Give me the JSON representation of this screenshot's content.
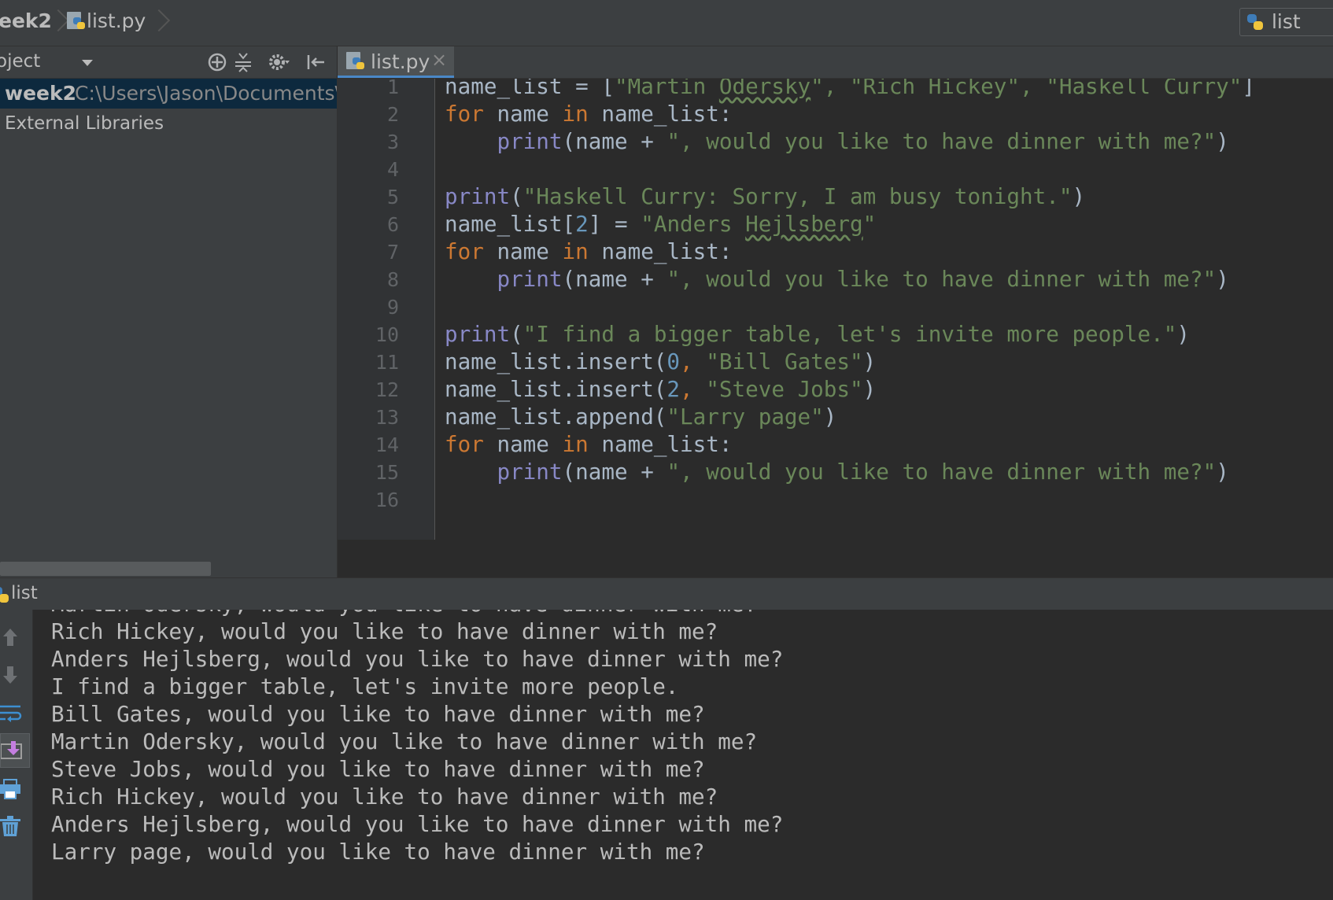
{
  "navbar": {
    "project_crumb": "eek2",
    "file_crumb": "list.py",
    "run_config_label": "list",
    "icons": [
      "python-file-icon",
      "chevron-right-icon"
    ]
  },
  "project_panel": {
    "title": "oject",
    "toolbar_icons": [
      "target-icon",
      "collapse-all-icon",
      "gear-icon",
      "hide-panel-icon"
    ],
    "tree": [
      {
        "name": "week2",
        "path": "C:\\Users\\Jason\\Documents\\C"
      },
      {
        "name": "External Libraries",
        "path": ""
      }
    ]
  },
  "editor": {
    "tab_label": "list.py",
    "tab_close": "×",
    "line_numbers": [
      "1",
      "2",
      "3",
      "4",
      "5",
      "6",
      "7",
      "8",
      "9",
      "10",
      "11",
      "12",
      "13",
      "14",
      "15",
      "16"
    ],
    "code": {
      "l1": [
        "name_list = [",
        "\"Martin ",
        "Odersky",
        "\", ",
        "\"Rich Hickey\", ",
        "\"Haskell Curry\"",
        "]"
      ],
      "l2": [
        "for",
        " name ",
        "in",
        " name_list:"
      ],
      "l3": [
        "    ",
        "print",
        "(name + ",
        "\", would you like to have dinner with me?\"",
        ")"
      ],
      "l5": [
        "print",
        "(",
        "\"Haskell Curry: Sorry, I am busy tonight.\"",
        ")"
      ],
      "l6": [
        "name_list[",
        "2",
        "] = ",
        "\"Anders ",
        "Hejlsberg",
        "\""
      ],
      "l7": [
        "for",
        " name ",
        "in",
        " name_list:"
      ],
      "l8": [
        "    ",
        "print",
        "(name + ",
        "\", would you like to have dinner with me?\"",
        ")"
      ],
      "l10": [
        "print",
        "(",
        "\"I find a bigger table, let's invite more people.\"",
        ")"
      ],
      "l11": [
        "name_list.insert(",
        "0",
        ", ",
        "\"Bill Gates\"",
        ")"
      ],
      "l12": [
        "name_list.insert(",
        "2",
        ", ",
        "\"Steve Jobs\"",
        ")"
      ],
      "l13": [
        "name_list.append(",
        "\"Larry page\"",
        ")"
      ],
      "l14": [
        "for",
        " name ",
        "in",
        " name_list:"
      ],
      "l15": [
        "    ",
        "print",
        "(name + ",
        "\", would you like to have dinner with me?\"",
        ")"
      ]
    }
  },
  "run_panel": {
    "title": "list",
    "toolbar_icons": [
      "up-arrow-icon",
      "down-arrow-icon",
      "soft-wrap-icon",
      "scroll-to-end-icon",
      "print-icon",
      "trash-icon"
    ],
    "output": [
      "Martin Odersky, would you like to have dinner with me?",
      "Rich Hickey, would you like to have dinner with me?",
      "Anders Hejlsberg, would you like to have dinner with me?",
      "I find a bigger table, let's invite more people.",
      "Bill Gates, would you like to have dinner with me?",
      "Martin Odersky, would you like to have dinner with me?",
      "Steve Jobs, would you like to have dinner with me?",
      "Rich Hickey, would you like to have dinner with me?",
      "Anders Hejlsberg, would you like to have dinner with me?",
      "Larry page, would you like to have dinner with me?"
    ]
  },
  "colors": {
    "keyword": "#cc7832",
    "builtin": "#8888c6",
    "string": "#6a8759",
    "number": "#6897bb",
    "identifier": "#a9b7c6",
    "selection": "#0d293e"
  }
}
